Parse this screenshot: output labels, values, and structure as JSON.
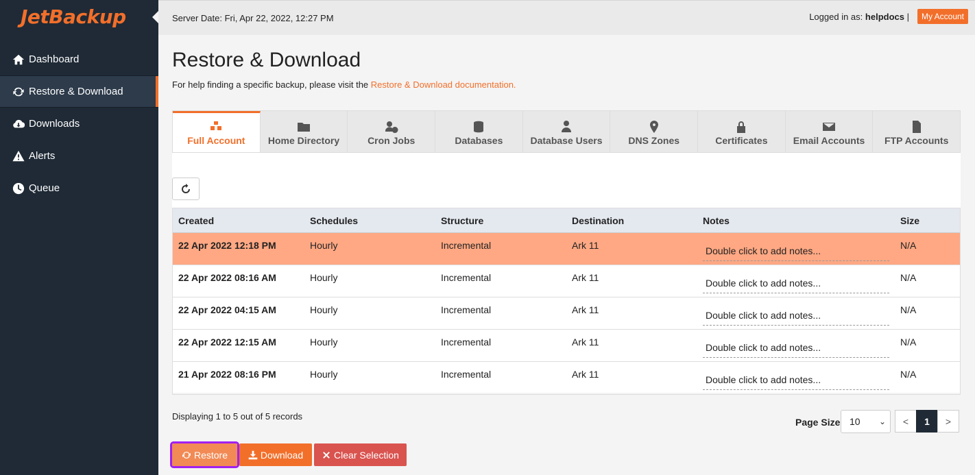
{
  "brand": {
    "logo_text": "JetBackup",
    "accent": "#f26f2a"
  },
  "sidebar": {
    "items": [
      {
        "label": "Dashboard",
        "icon": "home-icon",
        "active": false
      },
      {
        "label": "Restore & Download",
        "icon": "refresh-icon",
        "active": true
      },
      {
        "label": "Downloads",
        "icon": "cloud-download-icon",
        "active": false
      },
      {
        "label": "Alerts",
        "icon": "warning-icon",
        "active": false
      },
      {
        "label": "Queue",
        "icon": "clock-icon",
        "active": false
      }
    ]
  },
  "topbar": {
    "server_date": "Server Date: Fri, Apr 22, 2022, 12:27 PM",
    "logged_in_prefix": "Logged in as:",
    "username": "helpdocs",
    "separator": "|",
    "my_account_label": "My Account"
  },
  "page": {
    "title": "Restore & Download",
    "help_prefix": "For help finding a specific backup, please visit the",
    "help_link": "Restore & Download documentation."
  },
  "tabs": [
    {
      "label": "Full Account",
      "icon": "cubes-icon",
      "active": true
    },
    {
      "label": "Home Directory",
      "icon": "folder-icon",
      "active": false
    },
    {
      "label": "Cron Jobs",
      "icon": "user-clock-icon",
      "active": false
    },
    {
      "label": "Databases",
      "icon": "database-icon",
      "active": false
    },
    {
      "label": "Database Users",
      "icon": "user-tie-icon",
      "active": false
    },
    {
      "label": "DNS Zones",
      "icon": "map-marker-icon",
      "active": false
    },
    {
      "label": "Certificates",
      "icon": "lock-icon",
      "active": false
    },
    {
      "label": "Email Accounts",
      "icon": "envelope-icon",
      "active": false
    },
    {
      "label": "FTP Accounts",
      "icon": "file-icon",
      "active": false
    }
  ],
  "table": {
    "headers": [
      "Created",
      "Schedules",
      "Structure",
      "Destination",
      "Notes",
      "Size"
    ],
    "rows": [
      {
        "created": "22 Apr 2022 12:18 PM",
        "schedules": "Hourly",
        "structure": "Incremental",
        "destination": "Ark 11",
        "notes": "Double click to add notes...",
        "size": "N/A",
        "selected": true
      },
      {
        "created": "22 Apr 2022 08:16 AM",
        "schedules": "Hourly",
        "structure": "Incremental",
        "destination": "Ark 11",
        "notes": "Double click to add notes...",
        "size": "N/A",
        "selected": false
      },
      {
        "created": "22 Apr 2022 04:15 AM",
        "schedules": "Hourly",
        "structure": "Incremental",
        "destination": "Ark 11",
        "notes": "Double click to add notes...",
        "size": "N/A",
        "selected": false
      },
      {
        "created": "22 Apr 2022 12:15 AM",
        "schedules": "Hourly",
        "structure": "Incremental",
        "destination": "Ark 11",
        "notes": "Double click to add notes...",
        "size": "N/A",
        "selected": false
      },
      {
        "created": "21 Apr 2022 08:16 PM",
        "schedules": "Hourly",
        "structure": "Incremental",
        "destination": "Ark 11",
        "notes": "Double click to add notes...",
        "size": "N/A",
        "selected": false
      }
    ]
  },
  "footer": {
    "records_text": "Displaying 1 to 5 out of 5 records",
    "page_size_label": "Page Size",
    "page_size_value": "10",
    "pager": {
      "prev": "<",
      "current": "1",
      "next": ">"
    }
  },
  "actions": {
    "restore_label": "Restore",
    "download_label": "Download",
    "clear_label": "Clear Selection"
  },
  "colors": {
    "selected_row": "#ffa883",
    "sidebar_bg": "#1f2a36",
    "clear_button": "#d9534f",
    "highlight_outline": "#a020f0"
  }
}
